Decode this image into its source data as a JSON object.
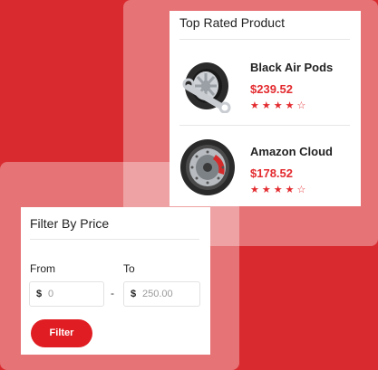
{
  "top_rated": {
    "title": "Top Rated Product",
    "products": [
      {
        "name": "Black Air Pods",
        "price": "$239.52",
        "rating": 4,
        "max_rating": 5,
        "image_icon": "wheel-with-wrench-icon"
      },
      {
        "name": "Amazon Cloud",
        "price": "$178.52",
        "rating": 4,
        "max_rating": 5,
        "image_icon": "brake-disc-tire-icon"
      }
    ]
  },
  "filter": {
    "title": "Filter By Price",
    "from_label": "From",
    "to_label": "To",
    "currency_symbol": "$",
    "from_value": "0",
    "to_value": "250.00",
    "separator": "-",
    "button_label": "Filter"
  },
  "colors": {
    "background": "#d92b2f",
    "accent": "#e01d22",
    "price": "#e32b2f"
  }
}
